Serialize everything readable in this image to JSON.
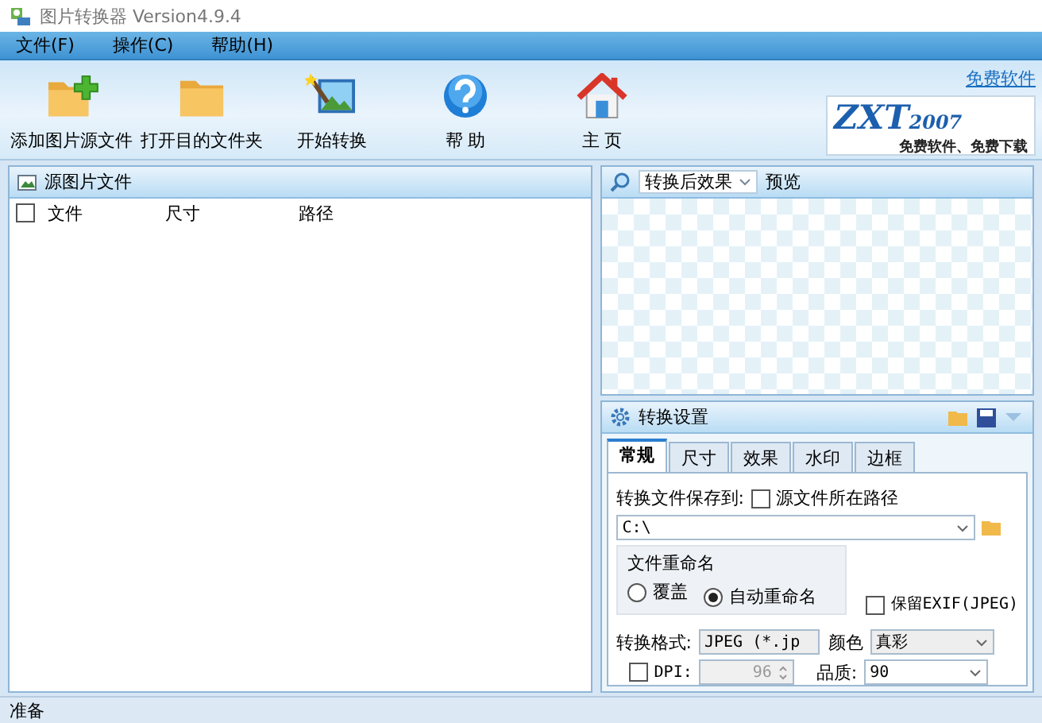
{
  "window": {
    "title": "图片转换器 Version4.9.4"
  },
  "menu": [
    {
      "label": "文件(F)"
    },
    {
      "label": "操作(C)"
    },
    {
      "label": "帮助(H)"
    }
  ],
  "toolbar": [
    {
      "kind": "add",
      "label": "添加图片源文件"
    },
    {
      "kind": "folder",
      "label": "打开目的文件夹"
    },
    {
      "kind": "convert",
      "label": "开始转换"
    },
    {
      "kind": "help",
      "label": "帮 助"
    },
    {
      "kind": "home",
      "label": "主 页"
    }
  ],
  "promo": {
    "link": "免费软件",
    "logo": "ZXT",
    "logo_year": "2007",
    "slogan": "免费软件、免费下载"
  },
  "source_panel": {
    "title": "源图片文件",
    "select_all": {
      "checked": false
    },
    "columns": [
      "文件",
      "尺寸",
      "路径"
    ]
  },
  "preview": {
    "mode": "转换后效果",
    "label": "预览"
  },
  "settings": {
    "title": "转换设置",
    "tabs": [
      {
        "label": "常规",
        "selected": true
      },
      {
        "label": "尺寸",
        "selected": false
      },
      {
        "label": "效果",
        "selected": false
      },
      {
        "label": "水印",
        "selected": false
      },
      {
        "label": "边框",
        "selected": false
      }
    ],
    "save_to_label": "转换文件保存到:",
    "same_path": {
      "label": "源文件所在路径",
      "checked": false
    },
    "path": "C:\\",
    "rename": {
      "title": "文件重命名",
      "options": [
        {
          "label": "覆盖",
          "selected": false
        },
        {
          "label": "自动重命名",
          "selected": true
        }
      ]
    },
    "keep_exif": {
      "label": "保留EXIF(JPEG)",
      "checked": false
    },
    "format": {
      "label": "转换格式:",
      "value": "JPEG (*.jp"
    },
    "color": {
      "label": "颜色",
      "value": "真彩"
    },
    "dpi": {
      "label": "DPI:",
      "checked": false,
      "value": "96"
    },
    "quality": {
      "label": "品质:",
      "value": "90"
    }
  },
  "status_bar": "准备"
}
